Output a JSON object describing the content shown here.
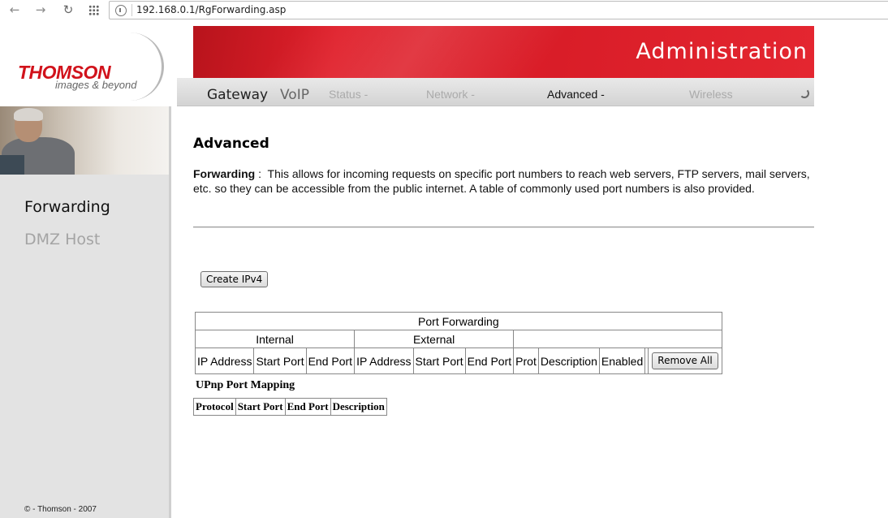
{
  "browser": {
    "url": "192.168.0.1/RgForwarding.asp"
  },
  "header": {
    "logo_main": "THOMSON",
    "logo_sub": "images & beyond",
    "banner_title": "Administration",
    "nav": [
      {
        "label": "Gateway"
      },
      {
        "label": "VoIP"
      },
      {
        "label": "Status -"
      },
      {
        "label": "Network -"
      },
      {
        "label": "Advanced -"
      },
      {
        "label": "Wireless"
      }
    ]
  },
  "sidebar": {
    "items": [
      {
        "label": "Forwarding",
        "active": true
      },
      {
        "label": "DMZ Host",
        "active": false
      }
    ],
    "copyright": "© - Thomson - 2007"
  },
  "main": {
    "title": "Advanced",
    "desc_term": "Forwarding",
    "desc_sep": " :  ",
    "desc_text": "This allows for incoming requests on specific port numbers to reach web servers, FTP servers, mail servers, etc. so they can be accessible from the public internet. A table of commonly used port numbers is also provided.",
    "create_button": "Create IPv4",
    "port_forwarding": {
      "title": "Port Forwarding",
      "group_internal": "Internal",
      "group_external": "External",
      "columns": [
        "IP Address",
        "Start Port",
        "End Port",
        "IP Address",
        "Start Port",
        "End Port",
        "Prot",
        "Description",
        "Enabled"
      ],
      "remove_all": "Remove All"
    },
    "upnp": {
      "title": "UPnp Port Mapping",
      "columns": [
        "Protocol",
        "Start Port",
        "End Port",
        "Description"
      ]
    }
  }
}
